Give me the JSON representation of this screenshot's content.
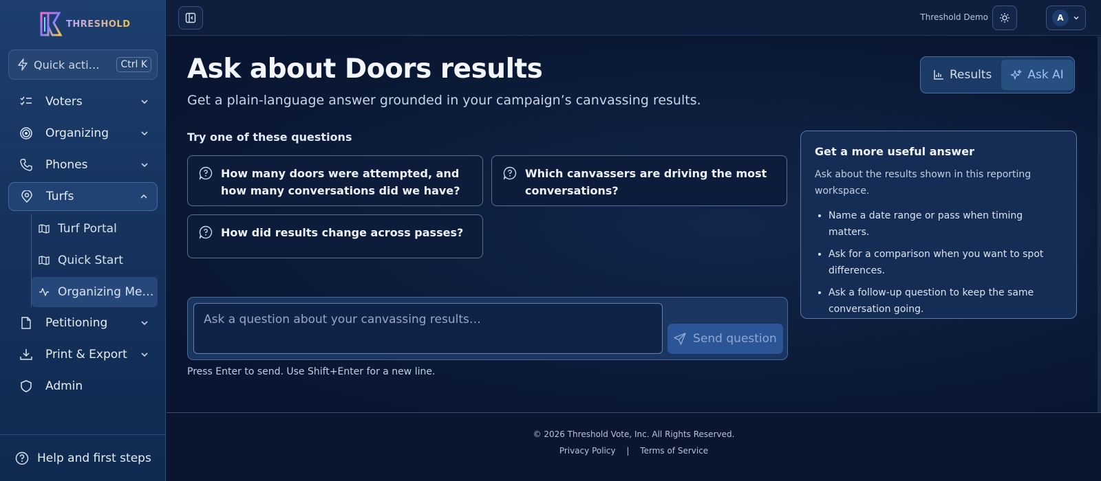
{
  "brand": {
    "name": "THRESHOLD"
  },
  "quick_actions": {
    "label": "Quick actions",
    "shortcut": "Ctrl K"
  },
  "nav": {
    "items": [
      {
        "label": "Voters",
        "icon": "checklist-icon"
      },
      {
        "label": "Organizing",
        "icon": "target-icon"
      },
      {
        "label": "Phones",
        "icon": "phone-icon"
      },
      {
        "label": "Turfs",
        "icon": "map-pin-icon"
      },
      {
        "label": "Petitioning",
        "icon": "document-icon"
      },
      {
        "label": "Print & Export",
        "icon": "download-icon"
      },
      {
        "label": "Admin",
        "icon": "shield-icon"
      }
    ],
    "turfs_sub": [
      {
        "label": "Turf Portal",
        "icon": "map-icon"
      },
      {
        "label": "Quick Start",
        "icon": "map-icon"
      },
      {
        "label": "Organizing Metrics",
        "icon": "activity-icon"
      }
    ],
    "help": "Help and first steps"
  },
  "topbar": {
    "org": "Threshold Demo",
    "avatar_initial": "A"
  },
  "page": {
    "title": "Ask about Doors results",
    "subtitle": "Get a plain-language answer grounded in your campaign’s canvassing results.",
    "tabs": {
      "results": "Results",
      "ask_ai": "Ask AI"
    },
    "try_heading": "Try one of these questions",
    "questions": [
      "How many doors were attempted, and how many conversations did we have?",
      "Which canvassers are driving the most conversations?",
      "How did results change across passes?"
    ],
    "input_placeholder": "Ask a question about your canvassing results…",
    "send_label": "Send question",
    "hint": "Press Enter to send. Use Shift+Enter for a new line."
  },
  "tips": {
    "title": "Get a more useful answer",
    "intro": "Ask about the results shown in this reporting workspace.",
    "items": [
      "Name a date range or pass when timing matters.",
      "Ask for a comparison when you want to spot differences.",
      "Ask a follow-up question to keep the same conversation going."
    ]
  },
  "footer": {
    "copyright": "© 2026 Threshold Vote, Inc. All Rights Reserved.",
    "privacy": "Privacy Policy",
    "separator": "|",
    "terms": "Terms of Service"
  },
  "colors": {
    "accent": "#2b5596",
    "sidebar": "#17345f",
    "background": "#0b1a36"
  }
}
